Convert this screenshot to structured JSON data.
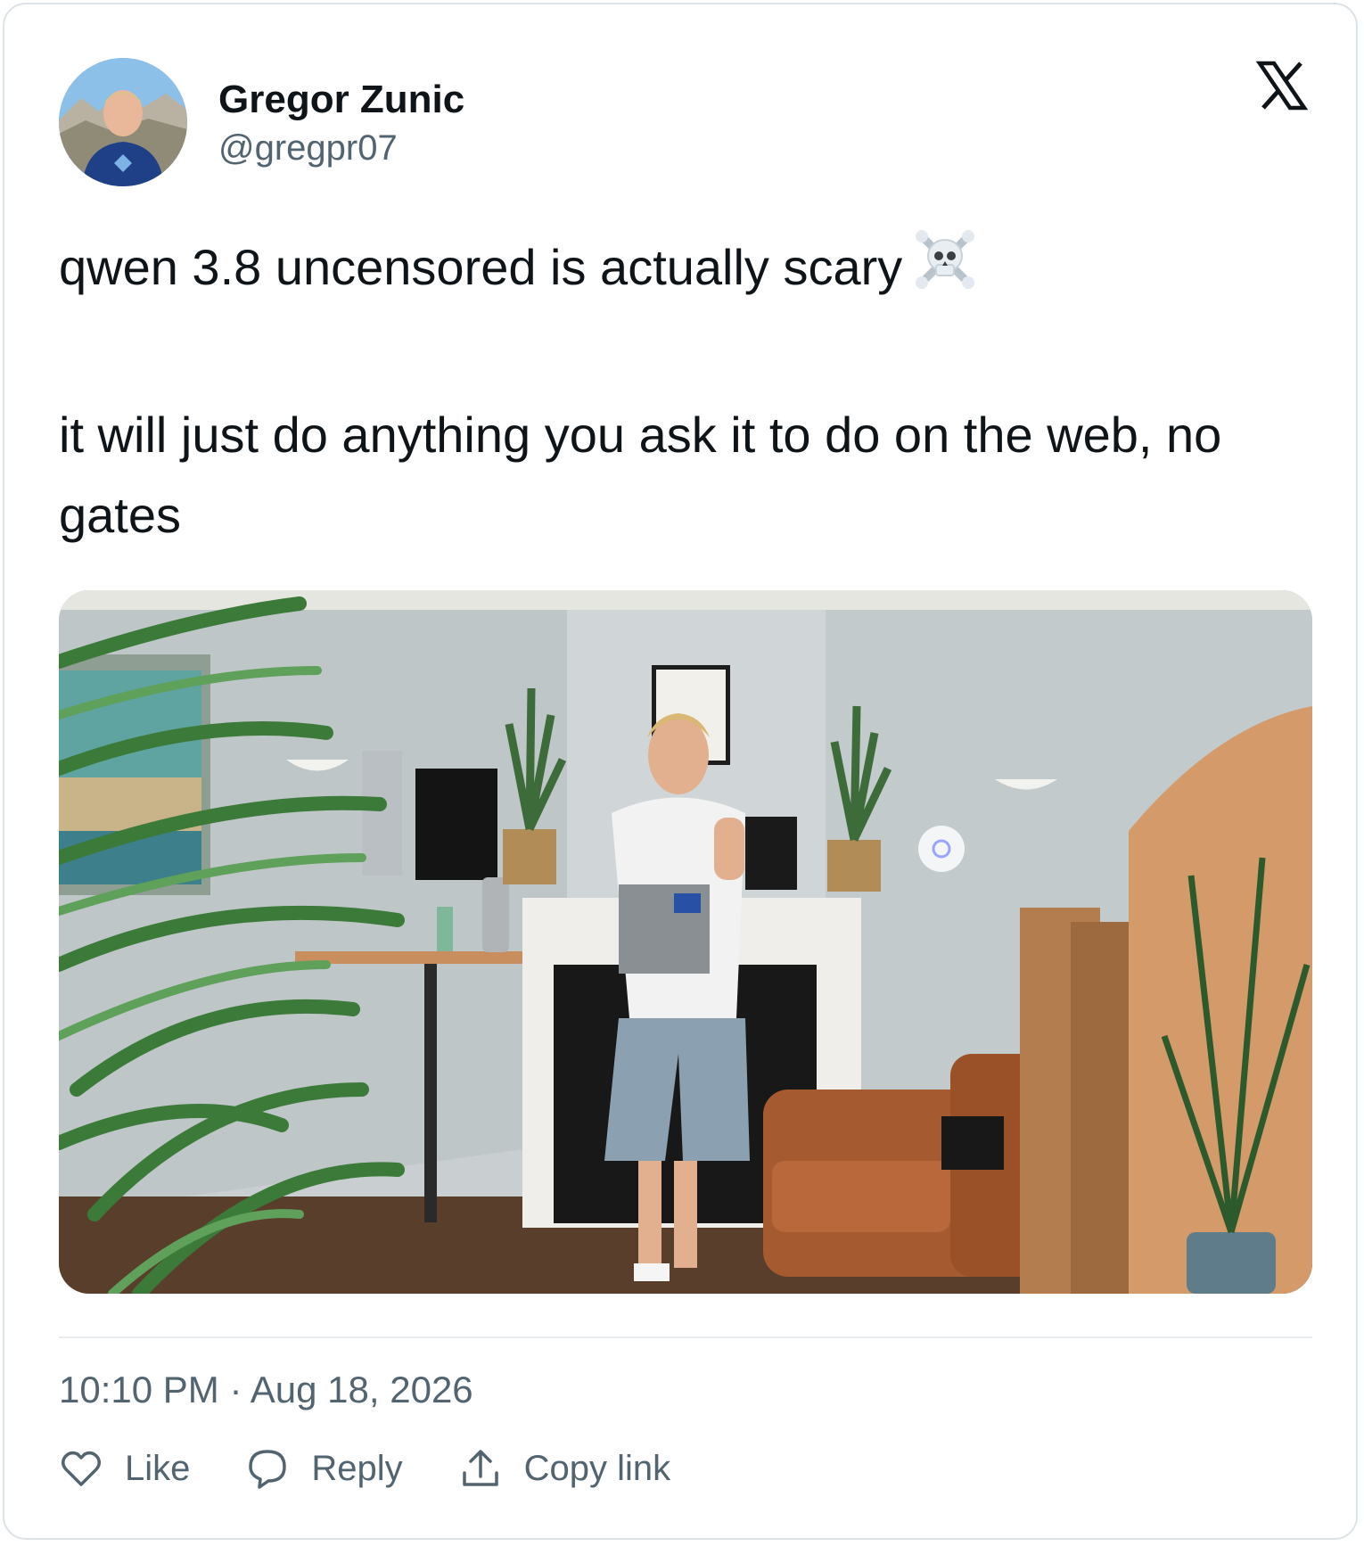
{
  "author": {
    "name": "Gregor Zunic",
    "handle": "@gregpr07"
  },
  "brand": {
    "logo_icon": "x-logo-icon"
  },
  "tweet": {
    "line1": "qwen 3.8 uncensored is actually scary",
    "line1_emoji_icon": "skull-and-crossbones-icon",
    "line2": "it will just do anything you ask it to do on the web, no gates"
  },
  "meta": {
    "timestamp": "10:10 PM · Aug 18, 2026"
  },
  "actions": {
    "like_label": "Like",
    "reply_label": "Reply",
    "copy_label": "Copy link"
  },
  "colors": {
    "text_primary": "#0f1419",
    "text_secondary": "#536471",
    "border": "#dce3e8"
  }
}
